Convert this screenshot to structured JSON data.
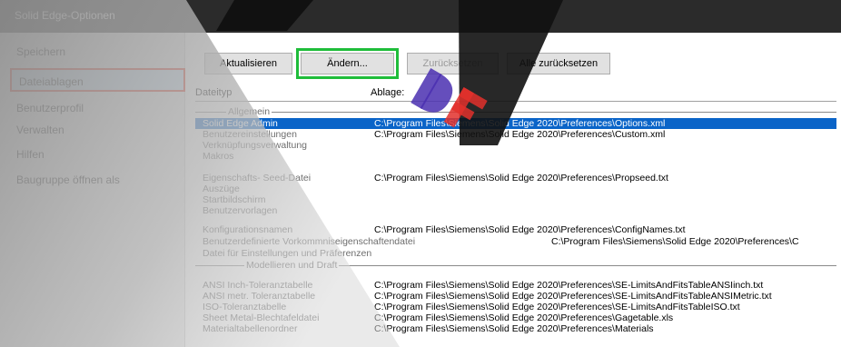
{
  "window": {
    "title": "Solid Edge-Optionen"
  },
  "sidebar": {
    "items": [
      {
        "label": "Speichern"
      },
      {
        "label": "Dateiablagen"
      },
      {
        "label": "Benutzerprofil"
      },
      {
        "label": "Verwalten"
      },
      {
        "label": "Hilfen"
      },
      {
        "label": "Baugruppe öffnen als"
      }
    ]
  },
  "toolbar": {
    "update_label": "Aktualisieren",
    "change_label": "Ändern...",
    "reset_label": "Zurücksetzen",
    "reset_all_label": "Alle zurücksetzen"
  },
  "table": {
    "headers": {
      "type": "Dateityp",
      "location": "Ablage:"
    },
    "groups": {
      "general": "Allgemein",
      "modeling": "Modellieren und Draft"
    },
    "rows": [
      {
        "name": "Solid Edge Admin",
        "path": "C:\\Program Files\\Siemens\\Solid Edge 2020\\Preferences\\Options.xml"
      },
      {
        "name": "Benutzereinstellungen",
        "path": "C:\\Program Files\\Siemens\\Solid Edge 2020\\Preferences\\Custom.xml"
      },
      {
        "name": "Verknüpfungsverwaltung",
        "path": ""
      },
      {
        "name": "Makros",
        "path": ""
      },
      {
        "name": "Eigenschafts- Seed-Datei",
        "path": "C:\\Program Files\\Siemens\\Solid Edge 2020\\Preferences\\Propseed.txt"
      },
      {
        "name": "Auszüge",
        "path": ""
      },
      {
        "name": "Startbildschirm",
        "path": ""
      },
      {
        "name": "Benutzervorlagen",
        "path": ""
      },
      {
        "name": "Konfigurationsnamen",
        "path": "C:\\Program Files\\Siemens\\Solid Edge 2020\\Preferences\\ConfigNames.txt"
      },
      {
        "name": "Benutzerdefinierte Vorkommniseigenschaftendatei",
        "path": "C:\\Program Files\\Siemens\\Solid Edge 2020\\Preferences\\C"
      },
      {
        "name": "Datei für Einstellungen und Präferenzen",
        "path": ""
      },
      {
        "name": "ANSI Inch-Toleranztabelle",
        "path": "C:\\Program Files\\Siemens\\Solid Edge 2020\\Preferences\\SE-LimitsAndFitsTableANSIinch.txt"
      },
      {
        "name": "ANSI metr. Toleranztabelle",
        "path": "C:\\Program Files\\Siemens\\Solid Edge 2020\\Preferences\\SE-LimitsAndFitsTableANSIMetric.txt"
      },
      {
        "name": "ISO-Toleranztabelle",
        "path": "C:\\Program Files\\Siemens\\Solid Edge 2020\\Preferences\\SE-LimitsAndFitsTableISO.txt"
      },
      {
        "name": "Sheet Metal-Blechtafeldatei",
        "path": "C:\\Program Files\\Siemens\\Solid Edge 2020\\Preferences\\Gagetable.xls"
      },
      {
        "name": "Materialtabellenordner",
        "path": "C:\\Program Files\\Siemens\\Solid Edge 2020\\Preferences\\Materials"
      }
    ]
  },
  "colors": {
    "selection": "#0a64c8",
    "highlight_box": "#1fbd3a",
    "sidebar_selected_border": "#e0301e"
  }
}
